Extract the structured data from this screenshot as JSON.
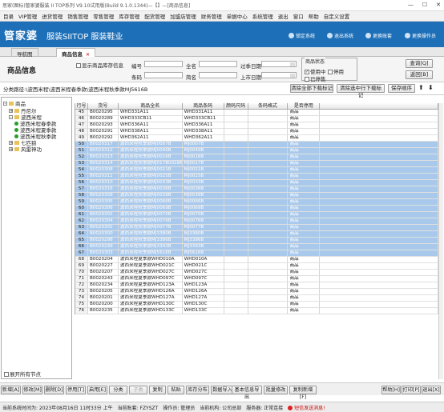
{
  "window": {
    "title": "思家(图标)管家婆服装 II TOP系列 V9.10试用版(Build 9.1.0.1344)—【】—[商品信息]",
    "controls": [
      "—",
      "☐",
      "✕"
    ]
  },
  "menu": [
    "目录",
    "VIP管理",
    "进货管理",
    "销售管理",
    "零售管理",
    "库存管理",
    "配货管理",
    "加盟店管理",
    "财务管理",
    "单据中心",
    "系统管理",
    "退出",
    "窗口",
    "帮助",
    "自定义设置"
  ],
  "banner": {
    "logo": "管家婆",
    "product": "服装SIITOP 服装鞋业",
    "actions": [
      "锁定系统",
      "退出系统",
      "更换账套",
      "更换操作员"
    ]
  },
  "tabs": [
    {
      "label": "导航图",
      "active": false
    },
    {
      "label": "商品信息",
      "active": true,
      "close": "✕"
    }
  ],
  "filter": {
    "page_title": "商品信息",
    "show_stock_label": "显示商品库存信息",
    "fields": {
      "code": "编号",
      "fullname": "全名",
      "expire": "过季日期",
      "barcode": "条码",
      "shortname": "简名",
      "launch": "上市日期"
    },
    "status": {
      "legend": "商品状态",
      "in_use": "使用中",
      "disabled": "停用",
      "stopped": "已停售"
    },
    "buttons": {
      "query": "查询[Q]",
      "back": "返回[B]"
    }
  },
  "path": {
    "text": "分类路径:\\波西米程\\波西米程春季款\\波西米程秋季款MJ5616B",
    "btn_clear_all": "清除全部下载标记",
    "btn_clear_sel": "清除选中行下载标记",
    "btn_save_order": "保存顺序",
    "up": "⬆",
    "down": "⬇"
  },
  "tree": {
    "root": "商品",
    "nodes": [
      {
        "label": "丹尼尔",
        "level": 1,
        "exp": "+"
      },
      {
        "label": "波西米程",
        "level": 1,
        "exp": "-"
      },
      {
        "label": "波西米程春季款",
        "level": 2,
        "exp": ""
      },
      {
        "label": "波西米程夏季款",
        "level": 2,
        "exp": ""
      },
      {
        "label": "波西米程秋季款",
        "level": 2,
        "exp": ""
      },
      {
        "label": "七匹狼",
        "level": 1,
        "exp": "+"
      },
      {
        "label": "风雷神功",
        "level": 1,
        "exp": "+"
      }
    ],
    "footer": "展开所有节点"
  },
  "table": {
    "headers": [
      "行号",
      "货号",
      "商品全名",
      "商品条码",
      "颜码尺码",
      "条码格式",
      "是否停用",
      ""
    ],
    "rows": [
      {
        "n": "45",
        "c": "B0020295",
        "name": "WHD331A11",
        "bar": "WHD331A11",
        "st": "商品",
        "sel": false
      },
      {
        "n": "46",
        "c": "B0020289",
        "name": "WHD333CB11",
        "bar": "WHD333CB11",
        "st": "商品",
        "sel": false
      },
      {
        "n": "47",
        "c": "B0020293",
        "name": "WHD336A11",
        "bar": "WHD336A11",
        "st": "商品",
        "sel": false
      },
      {
        "n": "48",
        "c": "B0020291",
        "name": "WHD338A11",
        "bar": "WHD338A11",
        "st": "商品",
        "sel": false
      },
      {
        "n": "49",
        "c": "B0020292",
        "name": "WHD362A11",
        "bar": "WHD362A11",
        "st": "商品",
        "sel": false
      },
      {
        "n": "50",
        "c": "B0020317",
        "name": "波西米程秋季款MJ0007B",
        "bar": "MJ0007B",
        "st": "商品",
        "sel": true
      },
      {
        "n": "51",
        "c": "B0020312",
        "name": "波西米程秋季款MJ0040B",
        "bar": "MJ0040B",
        "st": "商品",
        "sel": true
      },
      {
        "n": "52",
        "c": "B0020313",
        "name": "波西米程秋季款MJ0016B",
        "bar": "MJ0016B",
        "st": "商品",
        "sel": true
      },
      {
        "n": "53",
        "c": "B0020314",
        "name": "波西米程秋季款MJ017B0028B",
        "bar": "MJ0017B",
        "st": "商品",
        "sel": true
      },
      {
        "n": "54",
        "c": "B0020308",
        "name": "波西米程秋季款MJ0021B",
        "bar": "MJ0021B",
        "st": "商品",
        "sel": true
      },
      {
        "n": "55",
        "c": "B0020311",
        "name": "波西米程秋季款MJ0025B",
        "bar": "MJ0025B",
        "st": "商品",
        "sel": true
      },
      {
        "n": "56",
        "c": "B0020310",
        "name": "波西米程秋季款MJ0033B",
        "bar": "MJ0033B",
        "st": "商品",
        "sel": true
      },
      {
        "n": "57",
        "c": "B0020316",
        "name": "波西米程秋季款MJ0036B",
        "bar": "MJ0036B",
        "st": "商品",
        "sel": true
      },
      {
        "n": "58",
        "c": "B0020309",
        "name": "波西米程秋季款MJ0039B",
        "bar": "MJ0039B",
        "st": "商品",
        "sel": true
      },
      {
        "n": "59",
        "c": "B0020305",
        "name": "波西米程秋季款MJ0066B",
        "bar": "MJ0066B",
        "st": "商品",
        "sel": true
      },
      {
        "n": "60",
        "c": "B0020306",
        "name": "波西米程秋季款MJ0069B",
        "bar": "MJ0069B",
        "st": "商品",
        "sel": true
      },
      {
        "n": "61",
        "c": "B0020302",
        "name": "波西米程秋季款MJ0070B",
        "bar": "MJ0070B",
        "st": "商品",
        "sel": true
      },
      {
        "n": "62",
        "c": "B0020304",
        "name": "波西米程秋季款MJ0076B",
        "bar": "MJ0076B",
        "st": "商品",
        "sel": true
      },
      {
        "n": "63",
        "c": "B0020301",
        "name": "波西米程秋季款MJ0077B",
        "bar": "MJ0077B",
        "st": "商品",
        "sel": true
      },
      {
        "n": "64",
        "c": "B0020300",
        "name": "波西米程秋季款MJ3380B",
        "bar": "MJ3380B",
        "st": "商品",
        "sel": true
      },
      {
        "n": "65",
        "c": "B0020298",
        "name": "波西米程秋季款MJ3386B",
        "bar": "MJ3386B",
        "st": "商品",
        "sel": true
      },
      {
        "n": "66",
        "c": "B0020299",
        "name": "波西米程秋季款MJ3393B",
        "bar": "MJ3393B",
        "st": "商品",
        "sel": true
      },
      {
        "n": "67",
        "c": "B0020303",
        "name": "波西米程秋季款MJ5616B",
        "bar": "MJ5616B",
        "st": "商品",
        "sel": true
      },
      {
        "n": "68",
        "c": "B0020204",
        "name": "波西米程夏季款WHD010A",
        "bar": "WHD010A",
        "st": "商品",
        "sel": false
      },
      {
        "n": "69",
        "c": "B0020227",
        "name": "波西米程夏季款WHD021C",
        "bar": "WHD021C",
        "st": "商品",
        "sel": false
      },
      {
        "n": "70",
        "c": "B0020207",
        "name": "波西米程夏季款WHD027C",
        "bar": "WHD027C",
        "st": "商品",
        "sel": false
      },
      {
        "n": "71",
        "c": "B0020243",
        "name": "波西米程夏季款WHD097C",
        "bar": "WHD097C",
        "st": "商品",
        "sel": false
      },
      {
        "n": "72",
        "c": "B0020234",
        "name": "波西米程夏季款WHD123A",
        "bar": "WHD123A",
        "st": "商品",
        "sel": false
      },
      {
        "n": "73",
        "c": "B0020205",
        "name": "波西米程夏季款WHD126A",
        "bar": "WHD126A",
        "st": "商品",
        "sel": false
      },
      {
        "n": "74",
        "c": "B0020201",
        "name": "波西米程夏季款WHD127A",
        "bar": "WHD127A",
        "st": "商品",
        "sel": false
      },
      {
        "n": "75",
        "c": "B0020200",
        "name": "波西米程夏季款WHD130C",
        "bar": "WHD130C",
        "st": "商品",
        "sel": false
      },
      {
        "n": "76",
        "c": "B0020235",
        "name": "波西米程夏季款WHD133C",
        "bar": "WHD133C",
        "st": "商品",
        "sel": false
      }
    ]
  },
  "actions": {
    "left": [
      {
        "label": "新增[A]",
        "dis": false
      },
      {
        "label": "修改[M]",
        "dis": false
      },
      {
        "label": "删除[D]",
        "dis": false
      },
      {
        "label": "停用[T]",
        "dis": false
      },
      {
        "label": "启用[E]",
        "dis": false
      },
      {
        "label": "分类",
        "dis": false
      },
      {
        "label": "子类",
        "dis": true
      },
      {
        "label": "复制",
        "dis": false
      },
      {
        "label": "粘贴",
        "dis": false
      },
      {
        "label": "库存分布",
        "dis": false
      },
      {
        "label": "数据导入",
        "dis": false
      }
    ],
    "middle": [
      {
        "label": "基本信息导出"
      },
      {
        "label": "批量修改"
      },
      {
        "label": "复制新增[F]"
      }
    ],
    "right": [
      {
        "label": "帮助[H]"
      },
      {
        "label": "打印[P]"
      },
      {
        "label": "退出[X]"
      }
    ]
  },
  "status": {
    "time": "当前系统时间为: 2023年08月16日 11时33分 上午",
    "account": "当前账套: FZYSZT",
    "operator": "操作员: 管理员",
    "org": "当前机构: 公司总部",
    "server": "服务器: 正常连接",
    "sms": "短信发送消息!"
  },
  "colors": {
    "banner": "#1d6fb8",
    "selected_row": "#a9c9ec"
  }
}
